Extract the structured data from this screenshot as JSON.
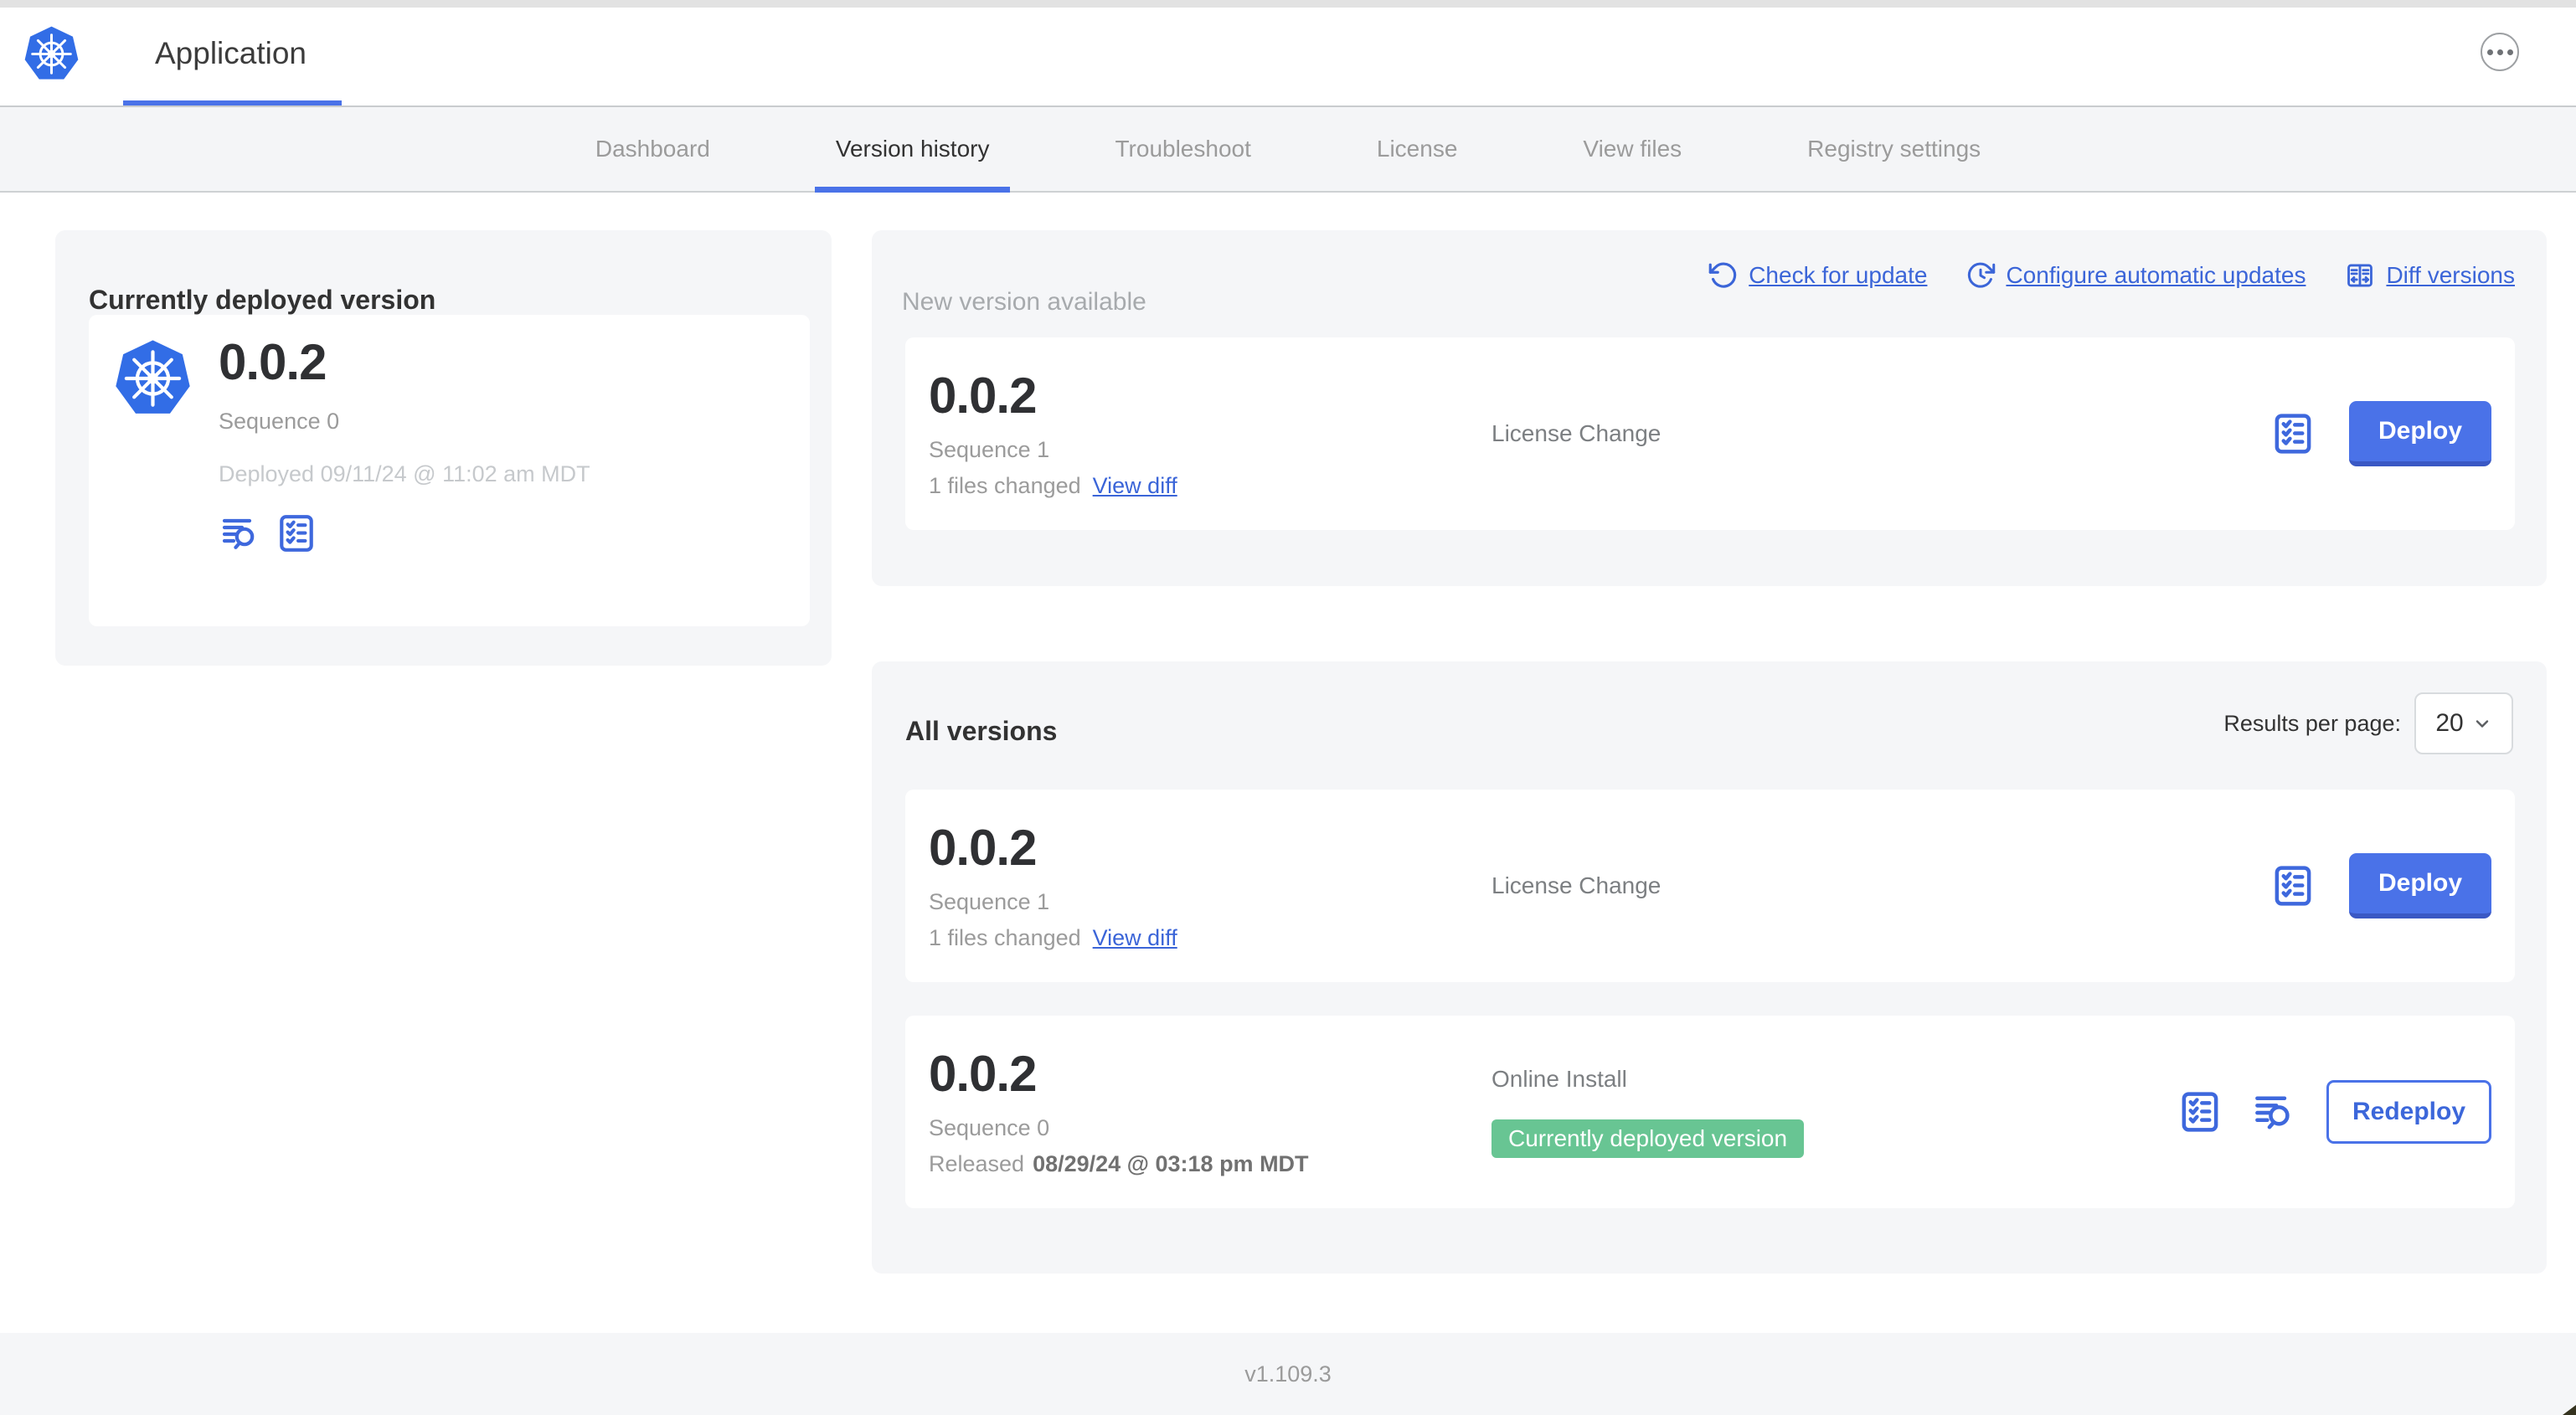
{
  "header": {
    "app_title": "Application",
    "logo_icon": "kubernetes-logo-icon",
    "menu_icon": "ellipsis-icon"
  },
  "nav": {
    "tabs": [
      {
        "label": "Dashboard",
        "active": false
      },
      {
        "label": "Version history",
        "active": true
      },
      {
        "label": "Troubleshoot",
        "active": false
      },
      {
        "label": "License",
        "active": false
      },
      {
        "label": "View files",
        "active": false
      },
      {
        "label": "Registry settings",
        "active": false
      }
    ]
  },
  "current_version_panel": {
    "title": "Currently deployed version",
    "version": "0.0.2",
    "sequence": "Sequence 0",
    "deployed": "Deployed 09/11/24 @ 11:02 am MDT",
    "icons": [
      "logs-icon",
      "preflight-checks-icon"
    ]
  },
  "new_version_panel": {
    "title": "New version available",
    "actions": [
      {
        "label": "Check for update",
        "icon": "refresh-icon"
      },
      {
        "label": "Configure automatic updates",
        "icon": "schedule-update-icon"
      },
      {
        "label": "Diff versions",
        "icon": "diff-icon"
      }
    ],
    "card": {
      "version": "0.0.2",
      "sequence": "Sequence 1",
      "files_changed": "1 files changed",
      "view_diff_label": "View diff",
      "change_type": "License Change",
      "preflight_icon": "preflight-checks-icon",
      "deploy_label": "Deploy"
    }
  },
  "all_versions_panel": {
    "title": "All versions",
    "results_per_page_label": "Results per page:",
    "results_per_page_value": "20",
    "rows": [
      {
        "version": "0.0.2",
        "sequence": "Sequence 1",
        "files_changed": "1 files changed",
        "view_diff_label": "View diff",
        "middle_text": "License Change",
        "button_label": "Deploy",
        "button_style": "primary",
        "icons": [
          "preflight-checks-icon"
        ]
      },
      {
        "version": "0.0.2",
        "sequence": "Sequence 0",
        "released_prefix": "Released",
        "released_date": "08/29/24 @ 03:18 pm MDT",
        "middle_text": "Online Install",
        "badge": "Currently deployed version",
        "button_label": "Redeploy",
        "button_style": "outline",
        "icons": [
          "preflight-checks-icon",
          "logs-icon"
        ]
      }
    ]
  },
  "footer": {
    "app_version": "v1.109.3"
  },
  "colors": {
    "accent_blue": "#3b65d8",
    "button_blue": "#4a72e8",
    "button_blue_shadow": "#3a58c4",
    "badge_green": "#68c593",
    "panel_gray": "#f5f6f8",
    "text_dark": "#323232",
    "text_gray": "#9b9b9b",
    "text_light_gray": "#c6c9cc",
    "text_mid_gray": "#7c7f82",
    "kubernetes_blue": "#326de6"
  }
}
